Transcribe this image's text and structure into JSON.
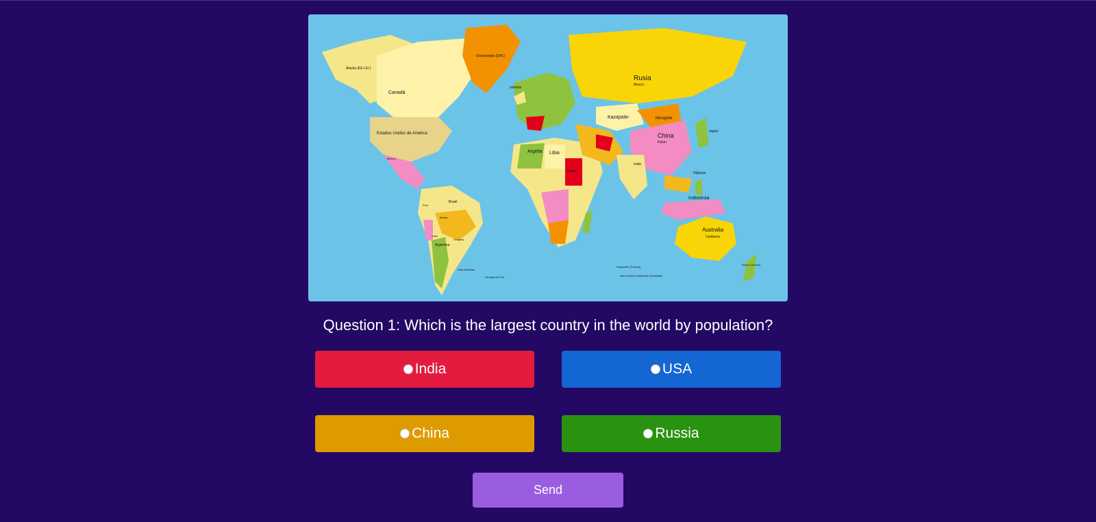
{
  "quiz": {
    "question": "Question 1: Which is the largest country in the world by population?",
    "options": [
      {
        "label": "India",
        "color": "#e31b3f"
      },
      {
        "label": "USA",
        "color": "#1466d2"
      },
      {
        "label": "China",
        "color": "#dd9b00"
      },
      {
        "label": "Russia",
        "color": "#2a9211"
      }
    ],
    "send_label": "Send",
    "send_color": "#9b5de0"
  },
  "map": {
    "labels": {
      "alaska": "Alaska (EE.UU.)",
      "canada": "Canadá",
      "usa": "Estados Unidos de América",
      "greenland": "Groenlandia (DIN.)",
      "russia": "Rusia",
      "russia_capital": "Moscú",
      "kazakhstan": "Kazajstán",
      "mongolia": "Mongolia",
      "china": "China",
      "china_capital": "Pekín",
      "india": "India",
      "indonesia": "Indonesia",
      "australia": "Australia",
      "australia_capital": "Canberra",
      "brazil": "Brasil",
      "argentina": "Argentina",
      "algeria": "Argelia",
      "libya": "Libia",
      "sudan": "Sudán",
      "iceland": "Islandia",
      "japan": "Japón",
      "philippines": "Filipinas",
      "new_zealand": "Nueva Zelanda",
      "falklands": "Islas Malvinas",
      "kerguelen": "Kerguelen (Francia)",
      "heard": "Islas Heard y McDonald (Australia)",
      "south_georgia": "Georgia del Sur",
      "mexico": "México",
      "peru": "Perú",
      "bolivia": "Bolivia",
      "chile": "Chile",
      "uruguay": "Uruguay"
    }
  }
}
